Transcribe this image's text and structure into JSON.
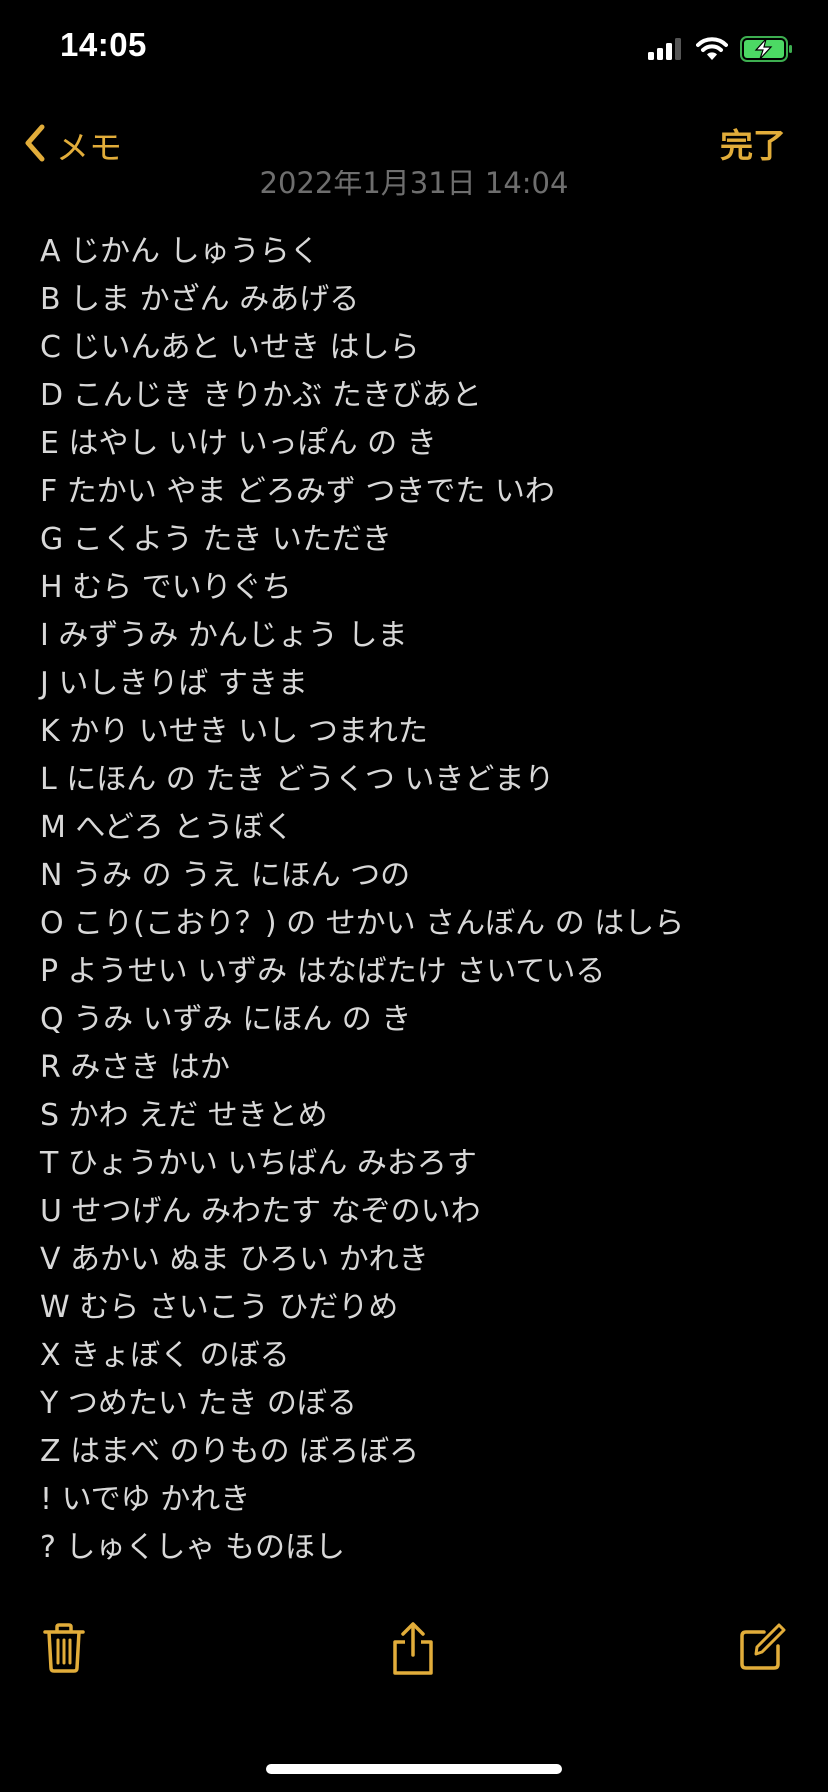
{
  "status_bar": {
    "time": "14:05",
    "icons": [
      "cellular-signal-icon",
      "wifi-icon",
      "battery-charging-icon"
    ],
    "battery_color": "#4cd964"
  },
  "nav": {
    "back_label": "メモ",
    "done_label": "完了",
    "back_icon": "chevron-left-icon",
    "accent_color": "#e2ad3a"
  },
  "note": {
    "date": "2022年1月31日 14:04",
    "lines": [
      "A じかん しゅうらく",
      "B しま かざん みあげる",
      "C じいんあと いせき はしら",
      "D こんじき きりかぶ たきびあと",
      "E はやし いけ いっぽん の き",
      "F たかい やま どろみず つきでた いわ",
      "G こくよう たき いただき",
      "H むら でいりぐち",
      "I みずうみ かんじょう しま",
      "J いしきりば すきま",
      "K かり いせき いし つまれた",
      "L にほん の たき どうくつ いきどまり",
      "M へどろ とうぼく",
      "N うみ の うえ にほん つの",
      "O こり(こおり？) の せかい さんぼん の はしら",
      "P ようせい いずみ はなばたけ さいている",
      "Q うみ いずみ にほん の き",
      "R みさき はか",
      "S かわ えだ せきとめ",
      "T ひょうかい いちばん みおろす",
      "U せつげん みわたす なぞのいわ",
      "V あかい ぬま ひろい かれき",
      "W むら さいこう ひだりめ",
      "X きょぼく のぼる",
      "Y つめたい たき のぼる",
      "Z はまべ のりもの ぼろぼろ",
      "! いでゆ かれき",
      "? しゅくしゃ ものほし"
    ]
  },
  "toolbar": {
    "icons": [
      "trash-icon",
      "share-icon",
      "compose-icon"
    ]
  }
}
